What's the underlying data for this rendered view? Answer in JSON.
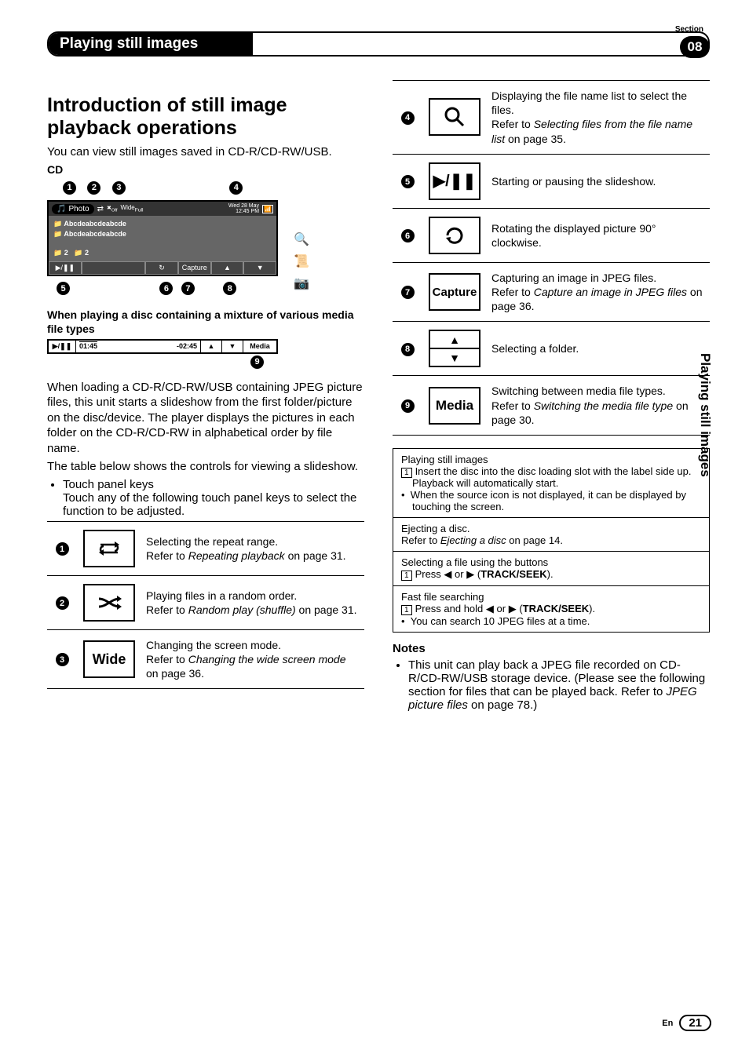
{
  "section_label": "Section",
  "section_number": "08",
  "chapter_title": "Playing still images",
  "side_tab": "Playing still images",
  "heading": "Introduction of still image playback operations",
  "intro_text": "You can view still images saved in CD-R/CD-RW/USB.",
  "cd_label": "CD",
  "ui": {
    "photo_label": "Photo",
    "off_label": "Off",
    "wide_label": "Wide",
    "full_label": "Full",
    "date": "Wed 28 May",
    "time": "12:45 PM",
    "list_item": "Abcdeabcdeabcde",
    "folder_count": "2",
    "capture_btn": "Capture",
    "callouts_top": [
      "1",
      "2",
      "3",
      "4"
    ],
    "callouts_bottom": [
      "5",
      "6",
      "7",
      "8"
    ]
  },
  "mixture_heading": "When playing a disc containing a mixture of various media file types",
  "playbar": {
    "time_elapsed": "01:45",
    "time_remaining": "-02:45",
    "media_label": "Media",
    "callout": "9"
  },
  "body_paragraph": "When loading a CD-R/CD-RW/USB containing JPEG picture files, this unit starts a slideshow from the first folder/picture on the disc/device. The player displays the pictures in each folder on the CD-R/CD-RW in alphabetical order by file name.",
  "body_paragraph2": "The table below shows the controls for viewing a slideshow.",
  "touch_panel_heading": "Touch panel keys",
  "touch_panel_sub": "Touch any of the following touch panel keys to select the function to be adjusted.",
  "controls": [
    {
      "n": "1",
      "icon": "repeat",
      "label": "",
      "desc_plain": "Selecting the repeat range.\nRefer to ",
      "desc_em": "Repeating playback",
      "desc_tail": " on page 31."
    },
    {
      "n": "2",
      "icon": "shuffle",
      "label": "",
      "desc_plain": "Playing files in a random order.\nRefer to ",
      "desc_em": "Random play (shuffle)",
      "desc_tail": " on page 31."
    },
    {
      "n": "3",
      "icon": "text",
      "label": "Wide",
      "desc_plain": "Changing the screen mode.\nRefer to ",
      "desc_em": "Changing the wide screen mode",
      "desc_tail": " on page 36."
    },
    {
      "n": "4",
      "icon": "search",
      "label": "",
      "desc_plain": "Displaying the file name list to select the files.\nRefer to ",
      "desc_em": "Selecting files from the file name list",
      "desc_tail": " on page 35."
    },
    {
      "n": "5",
      "icon": "playpause",
      "label": "",
      "desc_plain": "Starting or pausing the slideshow.",
      "desc_em": "",
      "desc_tail": ""
    },
    {
      "n": "6",
      "icon": "rotate",
      "label": "",
      "desc_plain": "Rotating the displayed picture 90° clockwise.",
      "desc_em": "",
      "desc_tail": ""
    },
    {
      "n": "7",
      "icon": "text",
      "label": "Capture",
      "desc_plain": "Capturing an image in JPEG files.\nRefer to ",
      "desc_em": "Capture an image in JPEG files",
      "desc_tail": " on page 36."
    },
    {
      "n": "8",
      "icon": "updown",
      "label": "",
      "desc_plain": "Selecting a folder.",
      "desc_em": "",
      "desc_tail": ""
    },
    {
      "n": "9",
      "icon": "text",
      "label": "Media",
      "desc_plain": "Switching between media file types.\nRefer to ",
      "desc_em": "Switching the media file type",
      "desc_tail": " on page 30."
    }
  ],
  "ops_box": {
    "r1_title": "Playing still images",
    "r1_step": "Insert the disc into the disc loading slot with the label side up.",
    "r1_line2": "Playback will automatically start.",
    "r1_bullet": "When the source icon is not displayed, it can be displayed by touching the screen.",
    "r2_title": "Ejecting a disc.",
    "r2_line": "Refer to ",
    "r2_em": "Ejecting a disc",
    "r2_tail": " on page 14.",
    "r3_title": "Selecting a file using the buttons",
    "r3_step_prefix": "Press ",
    "r3_step_mid": " or ",
    "r3_step_bold": "TRACK/SEEK",
    "r4_title": "Fast file searching",
    "r4_step_prefix": "Press and hold ",
    "r4_bullet": "You can search 10 JPEG files at a time."
  },
  "notes_heading": "Notes",
  "notes_bullet_prefix": "This unit can play back a JPEG file recorded on CD-R/CD-RW/USB storage device. (Please see the following section for files that can be played back. Refer to ",
  "notes_bullet_em": "JPEG picture files",
  "notes_bullet_tail": " on page 78.)",
  "page_lang": "En",
  "page_number": "21"
}
